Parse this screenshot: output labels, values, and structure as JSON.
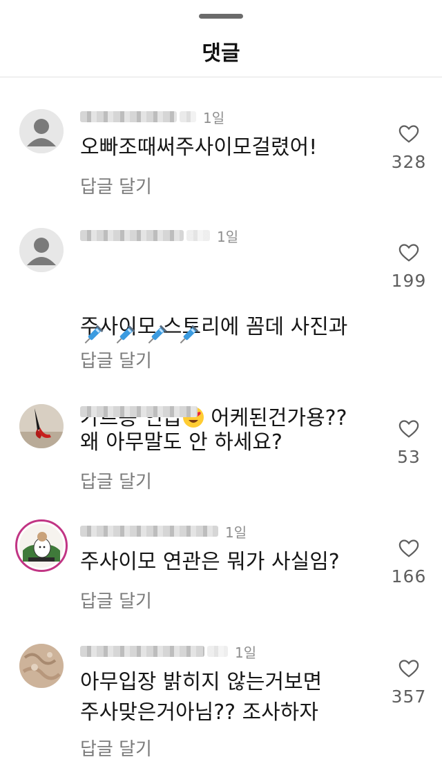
{
  "sheet": {
    "title": "댓글"
  },
  "comments": [
    {
      "time": "1일",
      "text": "오빠조때써주사이모걸렸어!",
      "reply": "답글 달기",
      "likes": "328"
    },
    {
      "time": "1일",
      "text_line1": "주사이모 스토리에 꼼데 사진과",
      "text_line2a": "가르송 언급",
      "text_line2b": " 어케된건가용??",
      "emoji": "heart-eyes-emoji",
      "extra": "syringe-emoji x4",
      "reply": "답글 달기",
      "likes": "199"
    },
    {
      "time": "",
      "text": "왜 아무말도 안 하세요?",
      "reply": "답글 달기",
      "likes": "53"
    },
    {
      "time": "1일",
      "text": "주사이모 연관은 뭐가 사실임?",
      "reply": "답글 달기",
      "likes": "166"
    },
    {
      "time": "1일",
      "text": "아무입장 밝히지 않는거보면\n주사맞은거아님?? 조사하자",
      "reply": "답글 달기",
      "likes": "357"
    }
  ],
  "colors": {
    "accent_ring": "#c13584",
    "muted_text": "#7a7a7a",
    "heart_outline": "#5e5e5e"
  }
}
